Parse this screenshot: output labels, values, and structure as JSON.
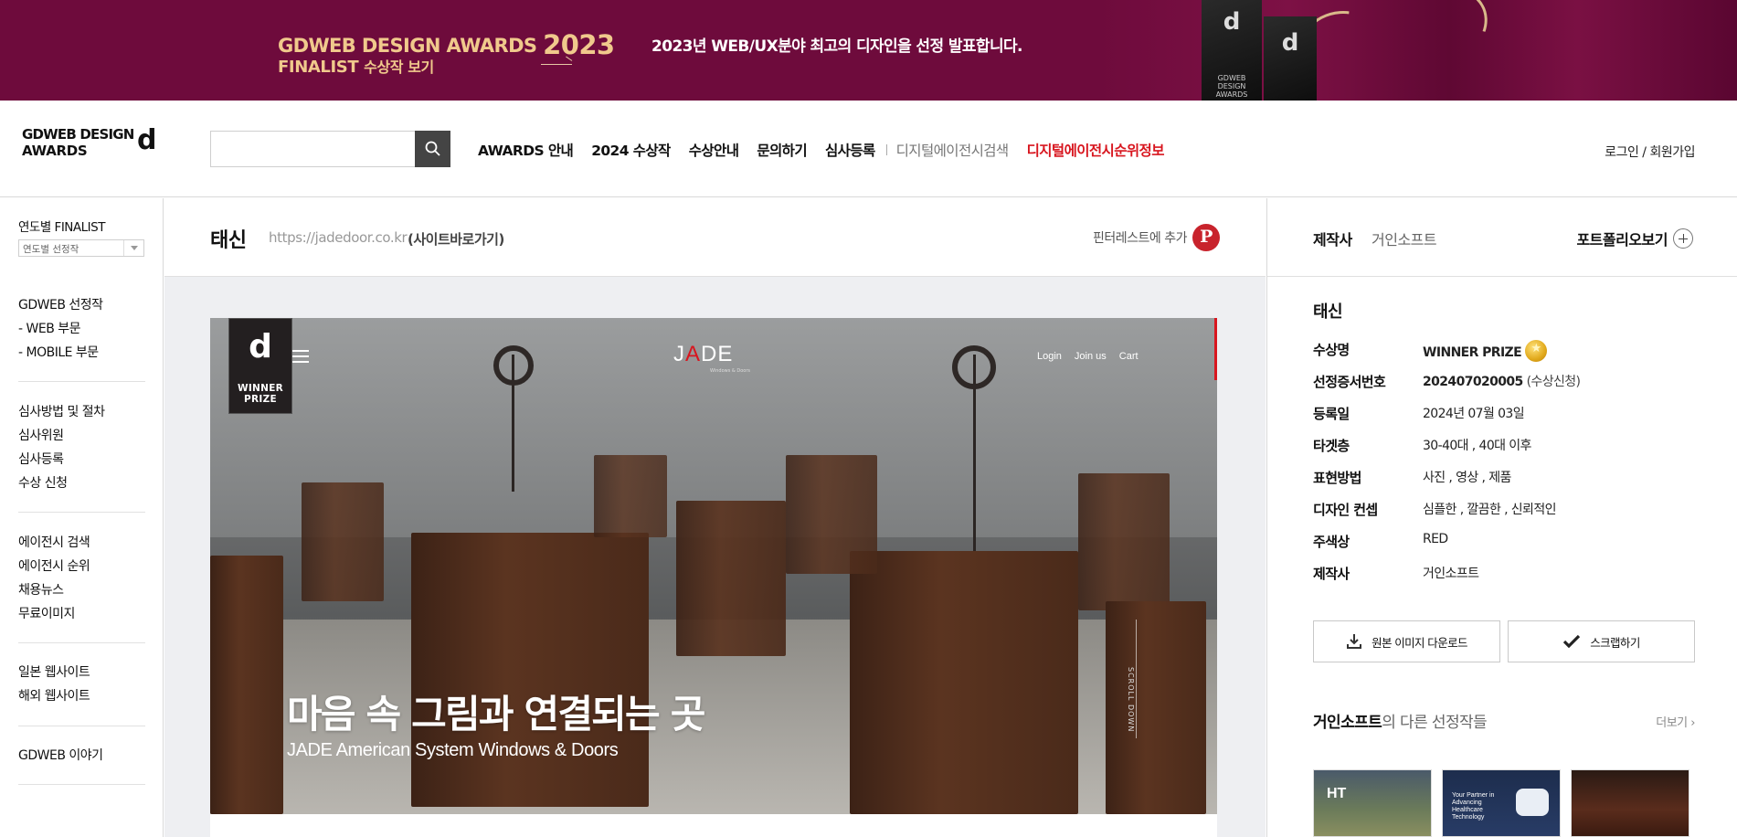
{
  "banner": {
    "title": "GDWEB DESIGN AWARDS",
    "year": "2023",
    "subtitle_a": "FINALIST",
    "subtitle_b": "수상작 보기",
    "tagline": "2023년 WEB/UX분야 최고의 디자인을 선정 발표합니다.",
    "trophy_label": "GDWEB DESIGN AWARDS"
  },
  "header": {
    "logo_line1": "GDWEB DESIGN",
    "logo_line2": "AWARDS",
    "search_placeholder": "",
    "nav": [
      {
        "label": "AWARDS 안내",
        "style": "bold"
      },
      {
        "label": "2024 수상작",
        "style": "bold"
      },
      {
        "label": "수상안내",
        "style": "bold"
      },
      {
        "label": "문의하기",
        "style": "bold"
      },
      {
        "label": "심사등록",
        "style": "bold"
      },
      {
        "label": "디지털에이전시검색",
        "style": "gray"
      },
      {
        "label": "디지털에이전시순위정보",
        "style": "red"
      }
    ],
    "auth": "로그인 / 회원가입"
  },
  "sidebar": {
    "year_label": "연도별 FINALIST",
    "year_select": "연도별 선정작",
    "group1": [
      "GDWEB 선정작",
      "- WEB 부문",
      "- MOBILE 부문"
    ],
    "group2": [
      "심사방법 및 절차",
      "심사위원",
      "심사등록",
      "수상 신청"
    ],
    "group3": [
      "에이전시 검색",
      "에이전시 순위",
      "채용뉴스",
      "무료이미지"
    ],
    "group4": [
      "일본 웹사이트",
      "해외 웹사이트"
    ],
    "group5": [
      "GDWEB 이야기"
    ]
  },
  "content": {
    "title": "태신",
    "url": "https://jadedoor.co.kr",
    "site_link": "(사이트바로가기)",
    "pinterest": "핀터레스트에 추가",
    "pinterest_icon": "pinterest-icon",
    "screenshot": {
      "badge_line1": "WINNER",
      "badge_line2": "PRIZE",
      "brand": "JADE",
      "brand_sub": "Windows & Doors",
      "nav": [
        "Login",
        "Join us",
        "Cart"
      ],
      "scroll": "SCROLL DOWN",
      "headline": "마음 속 그림과 연결되는 곳",
      "subheadline": "JADE American System Windows & Doors"
    }
  },
  "details": {
    "maker_label": "제작사",
    "maker_value": "거인소프트",
    "portfolio": "포트폴리오보기",
    "title": "태신",
    "rows": [
      {
        "k": "수상명",
        "v": "WINNER PRIZE"
      },
      {
        "k": "선정증서번호",
        "v": "202407020005",
        "v2": "(수상신청)"
      },
      {
        "k": "등록일",
        "v": "2024년 07월 03일"
      },
      {
        "k": "타겟층",
        "v": "30-40대 , 40대 이후"
      },
      {
        "k": "표현방법",
        "v": "사진 , 영상 , 제품"
      },
      {
        "k": "디자인 컨셉",
        "v": "심플한 , 깔끔한 , 신뢰적인"
      },
      {
        "k": "주색상",
        "v": "RED"
      },
      {
        "k": "제작사",
        "v": "거인소프트"
      }
    ],
    "download_button": "원본 이미지 다운로드",
    "scrap_button": "스크랩하기",
    "other_maker": "거인소프트",
    "other_suffix": "의 다른 선정작들",
    "more": "더보기",
    "thumbs": [
      {
        "text": "HT"
      },
      {
        "text": "Your Partner in Advancing Healthcare Technology"
      },
      {
        "text": ""
      }
    ]
  },
  "colors": {
    "banner_bg": "#6e0b3c",
    "banner_text": "#f0c98c",
    "accent_red": "#d8161f",
    "pinterest": "#c8232c"
  }
}
